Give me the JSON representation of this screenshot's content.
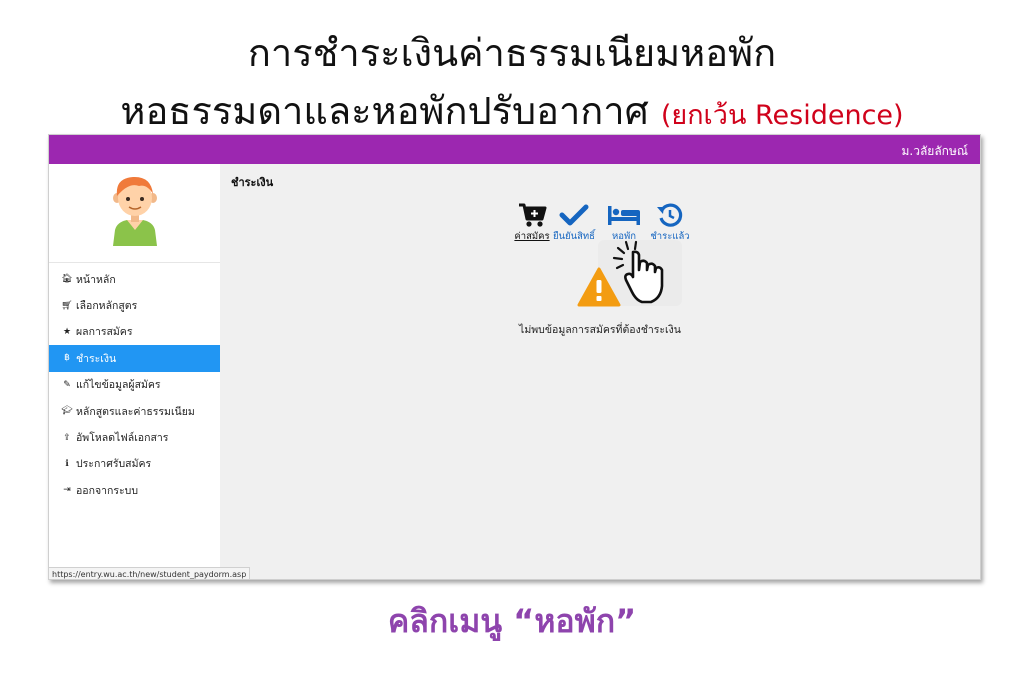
{
  "slide": {
    "title_line1": "การชำระเงินค่าธรรมเนียมหอพัก",
    "title_line2_main": "หอธรรมดาและหอพักปรับอากาศ",
    "title_line2_note": "(ยกเว้น Residence)",
    "caption": "คลิกเมนู “หอพัก”"
  },
  "header": {
    "user_name": "ม.วลัยลักษณ์",
    "bar_color": "#9c27b0"
  },
  "sidebar": {
    "items": [
      {
        "icon": "home-icon",
        "label": "หน้าหลัก",
        "active": false
      },
      {
        "icon": "cart-icon",
        "label": "เลือกหลักสูตร",
        "active": false
      },
      {
        "icon": "star-icon",
        "label": "ผลการสมัคร",
        "active": false
      },
      {
        "icon": "bitcoin-icon",
        "label": "ชำระเงิน",
        "active": true
      },
      {
        "icon": "pencil-icon",
        "label": "แก้ไขข้อมูลผู้สมัคร",
        "active": false
      },
      {
        "icon": "graduation-cap-icon",
        "label": "หลักสูตรและค่าธรรมเนียม",
        "active": false
      },
      {
        "icon": "upload-icon",
        "label": "อัพโหลดไฟล์เอกสาร",
        "active": false
      },
      {
        "icon": "info-icon",
        "label": "ประกาศรับสมัคร",
        "active": false
      },
      {
        "icon": "sign-out-icon",
        "label": "ออกจากระบบ",
        "active": false
      }
    ],
    "active_color": "#2196f3"
  },
  "main": {
    "page_title": "ชำระเงิน",
    "steps": [
      {
        "icon": "cart-plus-icon",
        "label": "ค่าสมัคร"
      },
      {
        "icon": "check-icon",
        "label": "ยืนยันสิทธิ์"
      },
      {
        "icon": "bed-icon",
        "label": "หอพัก"
      },
      {
        "icon": "history-icon",
        "label": "ชำระแล้ว"
      }
    ],
    "message": "ไม่พบข้อมูลการสมัครที่ต้องชำระเงิน",
    "warning_color": "#f39c12"
  },
  "status_url": "https://entry.wu.ac.th/new/student_paydorm.asp"
}
